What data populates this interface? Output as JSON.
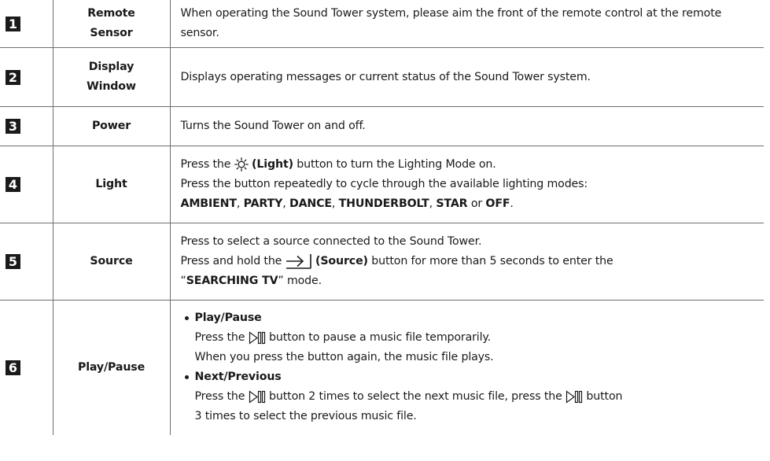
{
  "rows": [
    {
      "number": "1",
      "name": "Remote Sensor",
      "description": "When operating the Sound Tower system, please aim the front of the remote control at the remote sensor."
    },
    {
      "number": "2",
      "name": "Display Window",
      "description": "Displays operating messages or current status of the Sound Tower system."
    },
    {
      "number": "3",
      "name": "Power",
      "description": "Turns the Sound Tower on and off."
    },
    {
      "number": "4",
      "name": "Light",
      "line1_pre": "Press the",
      "line1_icon_label": "(Light)",
      "line1_post": "button to turn the Lighting Mode on.",
      "line2": "Press the button repeatedly to cycle through the available lighting modes:",
      "modes": [
        "AMBIENT",
        "PARTY",
        "DANCE",
        "THUNDERBOLT",
        "STAR"
      ],
      "mode_or": "or",
      "mode_last": "OFF",
      "icon": "sun-light-icon"
    },
    {
      "number": "5",
      "name": "Source",
      "line1": "Press to select a source connected to the Sound Tower.",
      "line2_pre": "Press and hold the",
      "line2_icon_label": "(Source)",
      "line2_post": "button for more than 5 seconds to enter the",
      "line3_quote_open": "“",
      "line3_mode": "SEARCHING TV",
      "line3_quote_close": "” mode.",
      "icon": "source-arrow-icon"
    },
    {
      "number": "6",
      "name": "Play/Pause",
      "bullets": [
        {
          "heading": "Play/Pause",
          "line1_pre": "Press the",
          "line1_post": "button to pause a music file temporarily.",
          "line2": "When you press the button again, the music file plays."
        },
        {
          "heading": "Next/Previous",
          "line1_pre": "Press the",
          "line1_mid": "button 2 times to select the next music file, press the",
          "line1_post": "button",
          "line2": "3 times to select the previous music file."
        }
      ],
      "icon": "play-pause-icon"
    }
  ],
  "colors": {
    "text": "#1a1a1a",
    "border": "#6f6f6f",
    "badge_bg": "#1a1a1a",
    "badge_text": "#ffffff"
  }
}
